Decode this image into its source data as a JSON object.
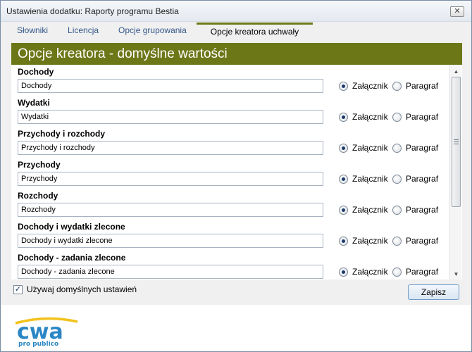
{
  "window": {
    "title": "Ustawienia dodatku: Raporty programu Bestia",
    "close_glyph": "✕"
  },
  "tabs": [
    {
      "label": "Słowniki"
    },
    {
      "label": "Licencja"
    },
    {
      "label": "Opcje grupowania"
    },
    {
      "label": "Opcje kreatora uchwały"
    }
  ],
  "active_tab": "Opcje kreatora uchwały",
  "header": {
    "title": "Opcje kreatora - domyślne wartości"
  },
  "rows": [
    {
      "label": "Dochody",
      "value": "Dochody",
      "selected": "Załącznik"
    },
    {
      "label": "Wydatki",
      "value": "Wydatki",
      "selected": "Załącznik"
    },
    {
      "label": "Przychody i rozchody",
      "value": "Przychody i rozchody",
      "selected": "Załącznik"
    },
    {
      "label": "Przychody",
      "value": "Przychody",
      "selected": "Załącznik"
    },
    {
      "label": "Rozchody",
      "value": "Rozchody",
      "selected": "Załącznik"
    },
    {
      "label": "Dochody i wydatki zlecone",
      "value": "Dochody i wydatki zlecone",
      "selected": "Załącznik"
    },
    {
      "label": "Dochody - zadania zlecone",
      "value": "Dochody - zadania zlecone",
      "selected": "Załącznik"
    }
  ],
  "radio_options": {
    "attachment": "Załącznik",
    "paragraph": "Paragraf"
  },
  "defaults_checkbox": {
    "label": "Używaj domyślnych ustawień",
    "checked": true,
    "glyph": "✓"
  },
  "save_button": {
    "label": "Zapisz"
  },
  "scrollbar": {
    "up_glyph": "▲",
    "down_glyph": "▼"
  },
  "logo": {
    "brand": "cwa",
    "tagline": "pro publico"
  },
  "colors": {
    "header_bg": "#6c7718",
    "tab_active_bar": "#6e7a1a",
    "logo_blue": "#2b86c4",
    "logo_yellow": "#f2c21b"
  }
}
